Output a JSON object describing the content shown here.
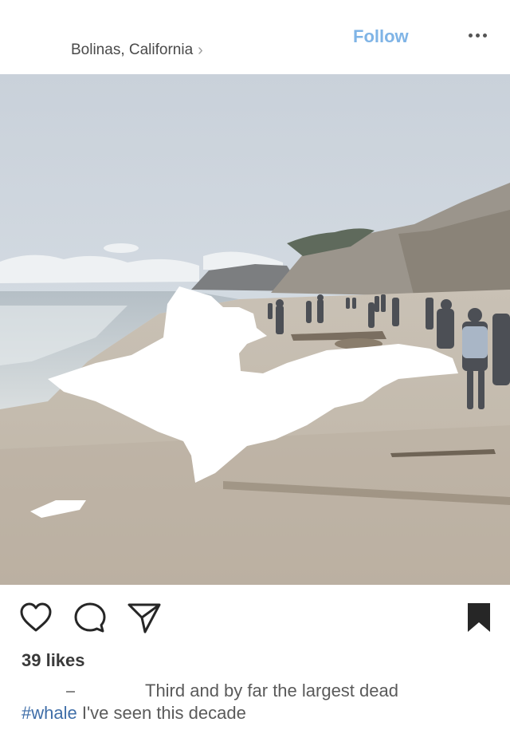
{
  "header": {
    "location": "Bolinas, California",
    "location_chevron": "›",
    "follow_label": "Follow",
    "more_icon": "more-horizontal-icon"
  },
  "post": {
    "photo_icon": "beach-photo",
    "actions": {
      "like_icon": "heart-icon",
      "comment_icon": "comment-icon",
      "share_icon": "send-icon",
      "save_icon": "bookmark-icon"
    },
    "likes_text": "39 likes",
    "caption_text": "Third and by far the largest dead",
    "caption_hashtag": "#whale",
    "caption_rest": "I've seen this decade"
  },
  "colors": {
    "follow": "#7fb4e6",
    "hashtag": "#3f6ea8"
  }
}
